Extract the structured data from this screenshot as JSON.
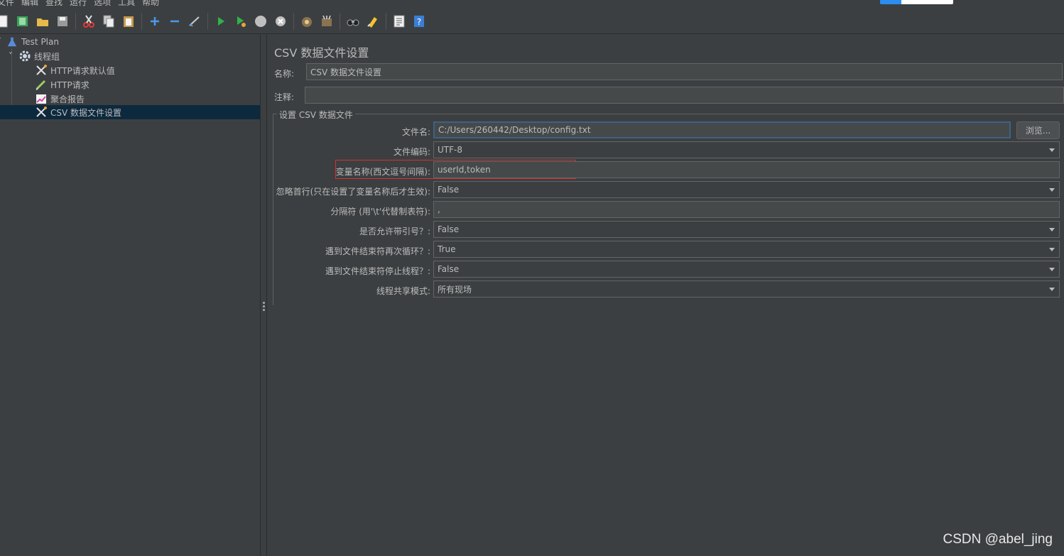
{
  "menu": {
    "items": [
      "文件",
      "编辑",
      "查找",
      "运行",
      "选项",
      "工具",
      "帮助"
    ]
  },
  "toolbar": {
    "buttons": [
      "new-icon",
      "templates-icon",
      "open-icon",
      "save-icon",
      "cut-icon",
      "copy-icon",
      "paste-icon",
      "expand-icon",
      "collapse-icon",
      "toggle-icon",
      "start-icon",
      "start-no-pause-icon",
      "stop-icon",
      "shutdown-icon",
      "clear-icon",
      "clear-all-icon",
      "search-icon",
      "reset-search-icon",
      "function-helper-icon",
      "help-icon"
    ]
  },
  "tree": {
    "items": [
      {
        "label": "Test Plan",
        "icon": "flask-icon"
      },
      {
        "label": "线程组",
        "icon": "gear-icon"
      },
      {
        "label": "HTTP请求默认值",
        "icon": "wrench-icon"
      },
      {
        "label": "HTTP请求",
        "icon": "pen-icon"
      },
      {
        "label": "聚合报告",
        "icon": "chart-icon"
      },
      {
        "label": "CSV 数据文件设置",
        "icon": "wrench-icon"
      }
    ]
  },
  "panel": {
    "title": "CSV 数据文件设置",
    "name_label": "名称:",
    "name_value": "CSV 数据文件设置",
    "comment_label": "注释:",
    "comment_value": "",
    "group_title": "设置 CSV 数据文件",
    "rows": [
      {
        "label": "文件名:",
        "value": "C:/Users/260442/Desktop/config.txt",
        "type": "text"
      },
      {
        "label": "文件编码:",
        "value": "UTF-8",
        "type": "select"
      },
      {
        "label": "变量名称(西文逗号间隔):",
        "value": "userId,token",
        "type": "text"
      },
      {
        "label": "忽略首行(只在设置了变量名称后才生效):",
        "value": "False",
        "type": "select"
      },
      {
        "label": "分隔符 (用'\\t'代替制表符):",
        "value": ",",
        "type": "text"
      },
      {
        "label": "是否允许带引号？:",
        "value": "False",
        "type": "select"
      },
      {
        "label": "遇到文件结束符再次循环？:",
        "value": "True",
        "type": "select"
      },
      {
        "label": "遇到文件结束符停止线程？:",
        "value": "False",
        "type": "select"
      },
      {
        "label": "线程共享模式:",
        "value": "所有现场",
        "type": "select"
      }
    ],
    "browse_label": "浏览..."
  },
  "watermark": "CSDN @abel_jing",
  "colors": {
    "background": "#3c3f41",
    "selection": "#0d293e",
    "highlight_box": "#d9312f",
    "text": "#bbbbbb"
  }
}
